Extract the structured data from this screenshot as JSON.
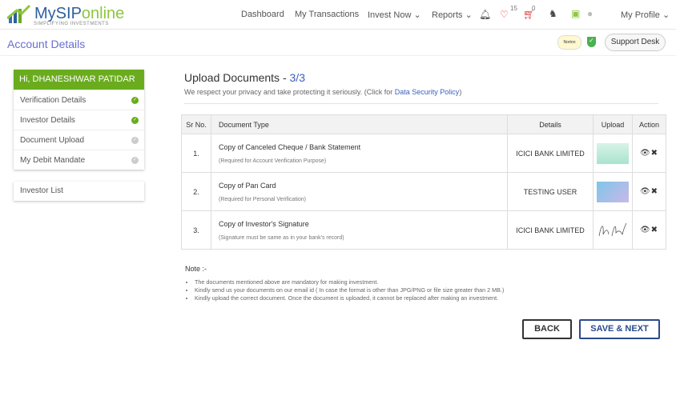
{
  "header": {
    "brand_a": "My",
    "brand_b": "SIP",
    "brand_c": "online",
    "tagline": "SIMPLIFYING INVESTMENTS",
    "nav": [
      "Dashboard",
      "My Transactions",
      "Invest Now",
      "Reports",
      "My Profile"
    ],
    "wishlist_count": "15",
    "cart_count": "0"
  },
  "subheader": {
    "title": "Account Details",
    "support": "Support Desk",
    "norton": "Norton"
  },
  "sidebar": {
    "greeting": "Hi, DHANESHWAR PATIDAR",
    "items": [
      {
        "label": "Verification Details",
        "done": true
      },
      {
        "label": "Investor Details",
        "done": true
      },
      {
        "label": "Document Upload",
        "done": false
      },
      {
        "label": "My Debit Mandate",
        "done": false
      }
    ],
    "investor_list": "Investor List"
  },
  "main": {
    "title": "Upload Documents - ",
    "step": "3/3",
    "privacy": "We respect your privacy and take protecting it seriously. (Click for ",
    "privacy_link": "Data Security Policy",
    "privacy_end": ")",
    "columns": [
      "Sr No.",
      "Document Type",
      "Details",
      "Upload",
      "Action"
    ],
    "rows": [
      {
        "sr": "1.",
        "doc": "Copy of Canceled Cheque / Bank Statement",
        "sub": "(Required for Account Verification Purpose)",
        "details": "ICICI BANK LIMITED"
      },
      {
        "sr": "2.",
        "doc": "Copy of Pan Card",
        "sub": "(Required for Personal Verification)",
        "details": "TESTING USER"
      },
      {
        "sr": "3.",
        "doc": "Copy of Investor's Signature",
        "sub": "(Signature must be same as in your bank's record)",
        "details": "ICICI BANK LIMITED"
      }
    ],
    "note_title": "Note :-",
    "notes": [
      "The documents mentioned above are mandatory for making investment.",
      "Kindly send us your documents on our email id ( In case the format is other than JPG/PNG or file size greater than 2 MB.)",
      "Kindly upload the correct document. Once the document is uploaded, it cannot be replaced after making an investment."
    ],
    "back": "BACK",
    "next": "SAVE & NEXT"
  },
  "colors": {
    "green": "#6aac1e",
    "blue": "#2a4a8c",
    "link": "#3b5fc0"
  }
}
